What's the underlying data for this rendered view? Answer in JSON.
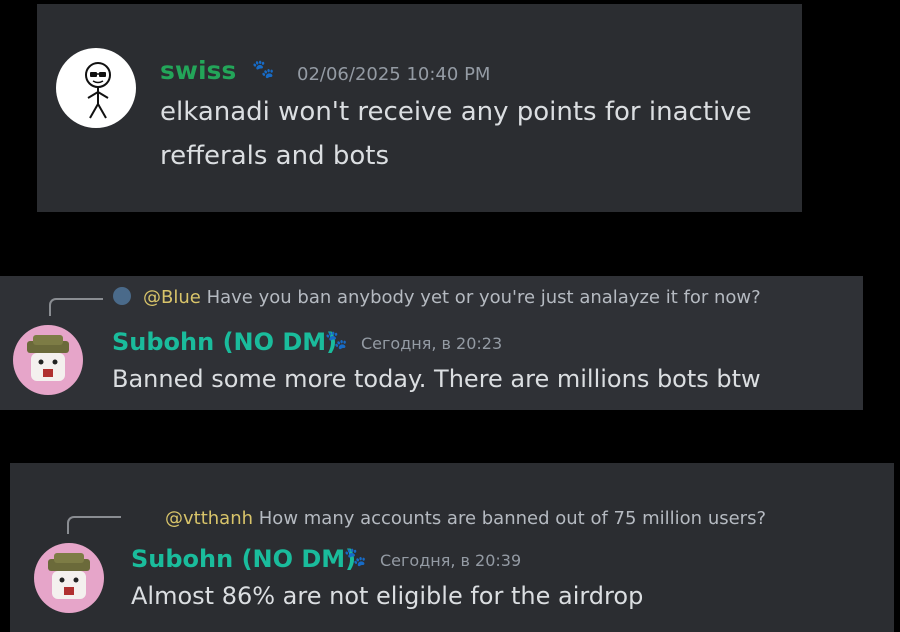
{
  "messages": [
    {
      "username": "swiss",
      "username_color": "#23a559",
      "badge_icon": "paw-icon",
      "timestamp": "02/06/2025 10:40 PM",
      "text_lines": [
        "elkanadi won't receive any points for inactive",
        "refferals and bots"
      ]
    },
    {
      "reply": {
        "mention": "@Blue",
        "text": "Have you ban anybody yet or you're just analayze it for now?"
      },
      "username": "Subohn (NO DM)",
      "username_color": "#1abc9c",
      "badge_icon": "paw-icon",
      "timestamp": "Сегодня, в 20:23",
      "text": "Banned some more today. There are millions bots btw"
    },
    {
      "reply": {
        "mention": "@vtthanh",
        "text": "How many accounts are banned out of 75 million users?"
      },
      "username": "Subohn (NO DM)",
      "username_color": "#1abc9c",
      "badge_icon": "paw-icon",
      "timestamp": "Сегодня, в 20:39",
      "text": "Almost 86% are not eligible for the airdrop"
    }
  ]
}
